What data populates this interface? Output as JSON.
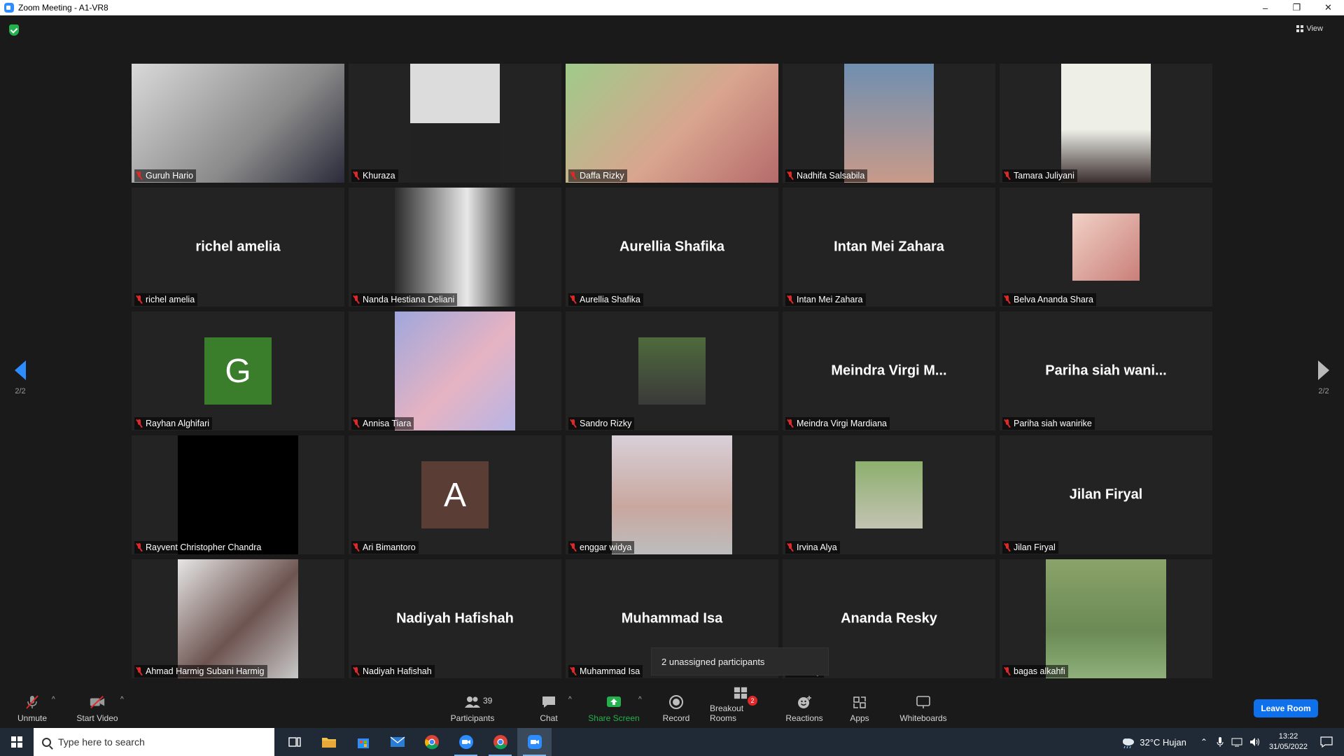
{
  "window": {
    "title": "Zoom Meeting - A1-VR8"
  },
  "view_label": "View",
  "pager": {
    "left": "2/2",
    "right": "2/2"
  },
  "tiles": [
    {
      "label": "Guruh Hario",
      "kind": "video",
      "vclass": "v-full",
      "bg": "linear-gradient(135deg,#d9d9d9,#8a8a8a 60%,#2a2a3a)"
    },
    {
      "label": "Khuraza",
      "kind": "video",
      "vclass": "v-narrow",
      "bg": "linear-gradient(180deg,#dcdcdc 50%,#222 50%)"
    },
    {
      "label": "Daffa Rizky",
      "kind": "video",
      "vclass": "v-full",
      "bg": "linear-gradient(135deg,#9ecb8a,#d9a58f 55%,#b56b6b)"
    },
    {
      "label": "Nadhifa Salsabila",
      "kind": "video",
      "vclass": "v-narrow",
      "bg": "linear-gradient(180deg,#6f8fb0,#c89a8a)"
    },
    {
      "label": "Tamara Juliyani",
      "kind": "video",
      "vclass": "v-narrow",
      "bg": "linear-gradient(180deg,#eef0e8 55%,#3a2e2e)"
    },
    {
      "label": "richel amelia",
      "kind": "name",
      "name": "richel amelia"
    },
    {
      "label": "Nanda Hestiana Deliani",
      "kind": "video",
      "vclass": "v-wide",
      "bg": "linear-gradient(90deg,#2b2b2b,#e8e8e8 60%,#2b2b2b)"
    },
    {
      "label": "Aurellia Shafika",
      "kind": "name",
      "name": "Aurellia Shafika"
    },
    {
      "label": "Intan Mei Zahara",
      "kind": "name",
      "name": "Intan Mei Zahara"
    },
    {
      "label": "Belva Ananda Shara",
      "kind": "thumb",
      "bg": "linear-gradient(135deg,#f1d1c6,#c97f79)"
    },
    {
      "label": "Rayhan Alghifari",
      "kind": "letter",
      "letter": "G",
      "color": "#3a7d2b"
    },
    {
      "label": "Annisa Tiara",
      "kind": "video",
      "vclass": "v-wide",
      "bg": "linear-gradient(135deg,#9fa7dd,#e6b3c2 55%,#b7b5e6)"
    },
    {
      "label": "Sandro Rizky",
      "kind": "thumb",
      "bg": "linear-gradient(180deg,#4f6a3c,#3a3a3a)"
    },
    {
      "label": "Meindra Virgi Mardiana",
      "kind": "name",
      "name": "Meindra Virgi M..."
    },
    {
      "label": "Pariha siah wanirike",
      "kind": "name",
      "name": "Pariha siah wani..."
    },
    {
      "label": "Rayvent Christopher Chandra",
      "kind": "video",
      "vclass": "v-wide",
      "bg": "#000000"
    },
    {
      "label": "Ari Bimantoro",
      "kind": "letter",
      "letter": "A",
      "color": "#5a3e36"
    },
    {
      "label": "enggar widya",
      "kind": "video",
      "vclass": "v-wide",
      "bg": "linear-gradient(180deg,#d8d0d8,#c9a79f 60%,#bdbdbd)"
    },
    {
      "label": "Irvina Alya",
      "kind": "thumb",
      "bg": "linear-gradient(180deg,#8db06e,#c3c3b3)"
    },
    {
      "label": "Jilan Firyal",
      "kind": "name",
      "name": "Jilan Firyal"
    },
    {
      "label": "Ahmad Harmig Subani Harmig",
      "kind": "video",
      "vclass": "v-wide",
      "bg": "linear-gradient(135deg,#e6e6e6,#6d5450 55%,#c8c8c8)"
    },
    {
      "label": "Nadiyah Hafishah",
      "kind": "name",
      "name": "Nadiyah Hafishah"
    },
    {
      "label": "Muhammad Isa",
      "kind": "name",
      "name": "Muhammad Isa"
    },
    {
      "label": "Resky",
      "kind": "name",
      "name": "Ananda Resky"
    },
    {
      "label": "bagas alkahfi",
      "kind": "video",
      "vclass": "v-wide",
      "bg": "linear-gradient(180deg,#8aa36a,#6b8a55 60%,#8fb07a)"
    }
  ],
  "popup": {
    "text": "2 unassigned participants"
  },
  "toolbar": {
    "unmute": "Unmute",
    "start_video": "Start Video",
    "participants": "Participants",
    "participants_count": "39",
    "chat": "Chat",
    "share_screen": "Share Screen",
    "record": "Record",
    "breakout_rooms": "Breakout Rooms",
    "breakout_badge": "2",
    "reactions": "Reactions",
    "apps": "Apps",
    "whiteboards": "Whiteboards",
    "leave": "Leave Room"
  },
  "taskbar": {
    "search_placeholder": "Type here to search",
    "weather": "32°C  Hujan",
    "time": "13:22",
    "date": "31/05/2022"
  },
  "colors": {
    "accent": "#2d8cff",
    "leave": "#0e71eb",
    "share": "#23b14d",
    "mute": "#e02828"
  }
}
